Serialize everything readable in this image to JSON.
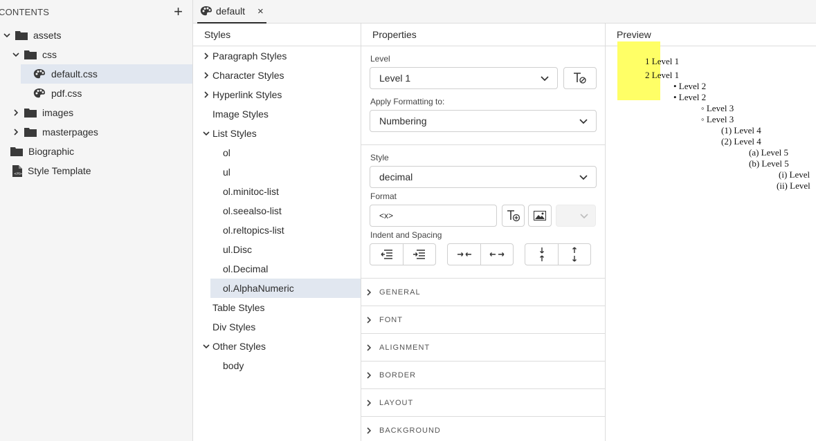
{
  "left_panel": {
    "title": "CONTENTS",
    "add_icon": "plus-icon",
    "tree": [
      {
        "label": "assets",
        "icon": "folder-icon",
        "expanded": true
      },
      {
        "label": "css",
        "icon": "folder-icon",
        "expanded": true
      },
      {
        "label": "default.css",
        "icon": "palette-icon",
        "selected": true
      },
      {
        "label": "pdf.css",
        "icon": "palette-icon"
      },
      {
        "label": "images",
        "icon": "folder-icon",
        "expanded": false
      },
      {
        "label": "masterpages",
        "icon": "folder-icon",
        "expanded": false
      },
      {
        "label": "Biographic",
        "icon": "folder-icon"
      },
      {
        "label": "Style Template",
        "icon": "document-icon"
      }
    ]
  },
  "tab": {
    "label": "default",
    "close": "×"
  },
  "styles": {
    "header": "Styles",
    "items": [
      {
        "label": "Paragraph Styles",
        "chevron": "right"
      },
      {
        "label": "Character Styles",
        "chevron": "right"
      },
      {
        "label": "Hyperlink Styles",
        "chevron": "right"
      },
      {
        "label": "Image Styles",
        "chevron": "none"
      },
      {
        "label": "List Styles",
        "chevron": "down"
      },
      {
        "label": "ol"
      },
      {
        "label": "ul"
      },
      {
        "label": "ol.minitoc-list"
      },
      {
        "label": "ol.seealso-list"
      },
      {
        "label": "ol.reltopics-list"
      },
      {
        "label": "ul.Disc"
      },
      {
        "label": "ol.Decimal"
      },
      {
        "label": "ol.AlphaNumeric",
        "selected": true
      },
      {
        "label": "Table Styles",
        "chevron": "none"
      },
      {
        "label": "Div Styles",
        "chevron": "none"
      },
      {
        "label": "Other Styles",
        "chevron": "down"
      },
      {
        "label": "body"
      }
    ]
  },
  "properties": {
    "header": "Properties",
    "level_label": "Level",
    "level_value": "Level 1",
    "apply_label": "Apply Formatting to:",
    "apply_value": "Numbering",
    "style_label": "Style",
    "style_value": "decimal",
    "format_label": "Format",
    "format_value": "<x>",
    "indent_label": "Indent and Spacing",
    "sections": [
      "GENERAL",
      "FONT",
      "ALIGNMENT",
      "BORDER",
      "LAYOUT",
      "BACKGROUND"
    ]
  },
  "preview": {
    "header": "Preview",
    "lines": [
      "1 Level 1",
      "2 Level 1",
      "• Level 2",
      "• Level 2",
      "◦ Level 3",
      "◦ Level 3",
      "(1) Level 4",
      "(2) Level 4",
      "(a) Level 5",
      "(b) Level 5",
      "(i) Level",
      "(ii) Level"
    ]
  },
  "colors": {
    "selection": "#e1e7f0",
    "highlight": "#ffff66",
    "border": "#dcdcdc"
  }
}
